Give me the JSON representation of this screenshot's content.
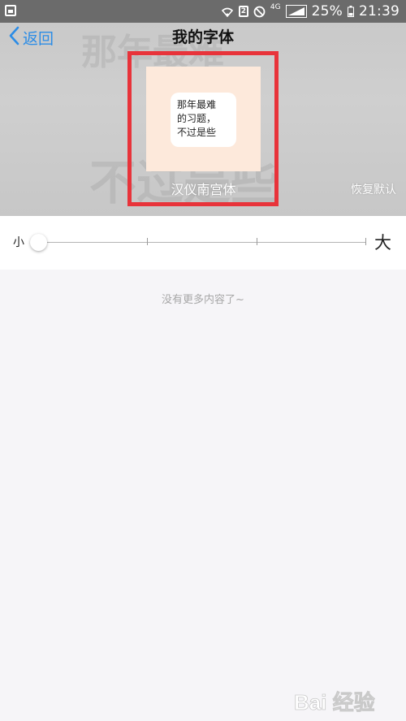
{
  "status_bar": {
    "battery_percent": "25%",
    "time": "21:39",
    "network_label": "4G",
    "sim_label": "2"
  },
  "nav": {
    "back_label": "返回",
    "title": "我的字体"
  },
  "preview": {
    "sample_lines": [
      "那年最难",
      "的习题，",
      "不过是些"
    ],
    "font_name": "汉仪南宫体",
    "restore_default_label": "恢复默认",
    "card_color": "#fde9db",
    "highlight_color": "#e8333a"
  },
  "font_size": {
    "small_label": "小",
    "large_label": "大",
    "level_index": 0,
    "level_count": 4
  },
  "footer_text": "没有更多内容了~",
  "watermark": {
    "text": "Bai 经验"
  },
  "colors": {
    "accent": "#2b8ce6",
    "background": "#f6f5f8"
  }
}
